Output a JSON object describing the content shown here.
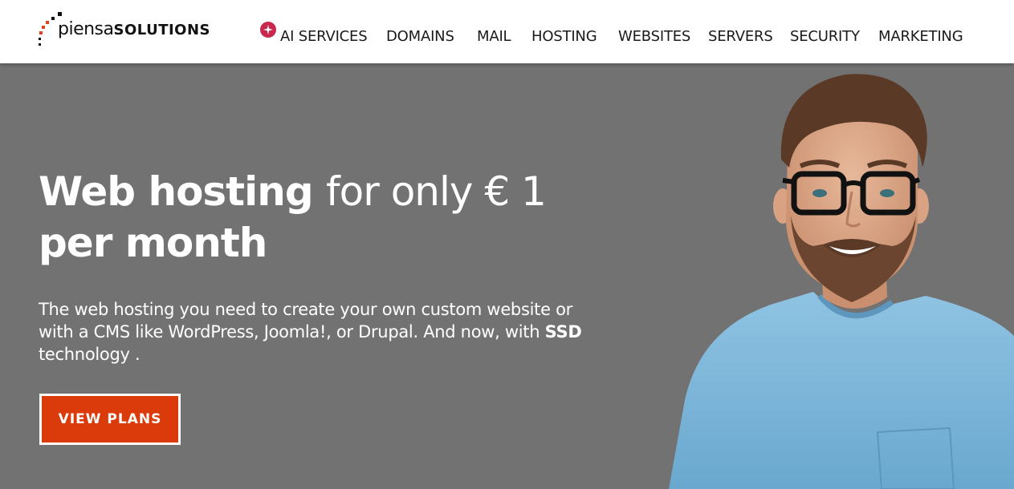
{
  "brand": {
    "logo_light": "piensa",
    "logo_bold": "SOLUTIONS",
    "colors": {
      "accent": "#db3b0a",
      "hero_bg": "#727272",
      "ai_badge": "#c8284e"
    }
  },
  "nav": {
    "items": [
      {
        "label": "AI SERVICES",
        "icon": "sparkle-icon"
      },
      {
        "label": "DOMAINS"
      },
      {
        "label": "MAIL"
      },
      {
        "label": "HOSTING"
      },
      {
        "label": "WEBSITES"
      },
      {
        "label": "SERVERS"
      },
      {
        "label": "SECURITY"
      },
      {
        "label": "MARKETING"
      }
    ]
  },
  "hero": {
    "headline_strong": "Web hosting",
    "headline_light": "for only € 1",
    "headline_line2": "per month",
    "sub_before": "The web hosting you need to create your own custom website or with a CMS like WordPress, Joomla!, or Drupal. And now, with ",
    "sub_bold": "SSD",
    "sub_after": " technology .",
    "cta_label": "VIEW PLANS"
  }
}
